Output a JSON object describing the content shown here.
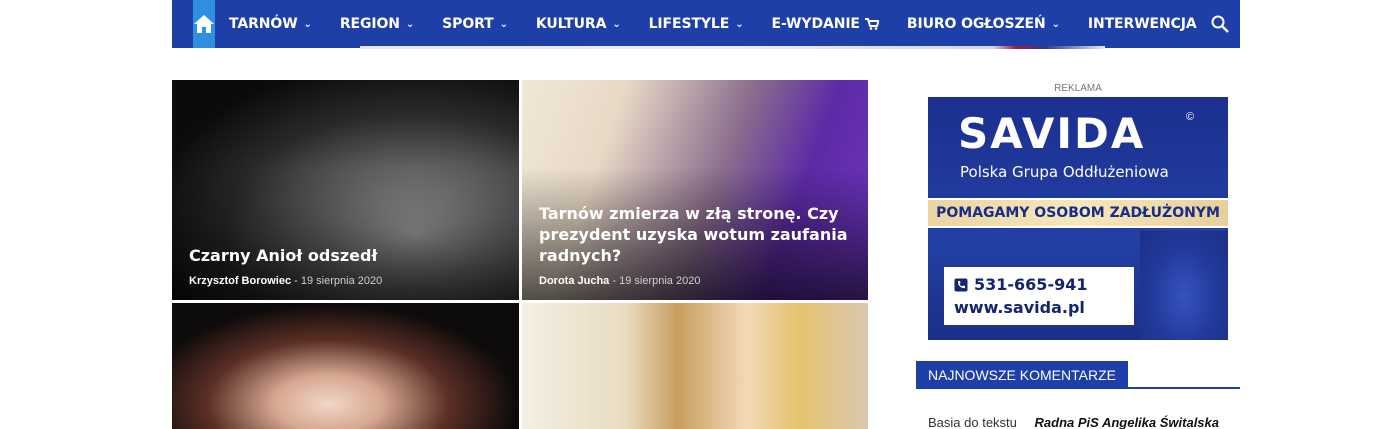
{
  "nav": {
    "items": [
      {
        "label": "TARNÓW",
        "has_dropdown": true
      },
      {
        "label": "REGION",
        "has_dropdown": true
      },
      {
        "label": "SPORT",
        "has_dropdown": true
      },
      {
        "label": "KULTURA",
        "has_dropdown": true
      },
      {
        "label": "LIFESTYLE",
        "has_dropdown": true
      },
      {
        "label": "E-WYDANIE",
        "has_dropdown": false
      },
      {
        "label": "BIURO OGŁOSZEŃ",
        "has_dropdown": true
      },
      {
        "label": "INTERWENCJA",
        "has_dropdown": false
      }
    ],
    "icons": {
      "home": "home-icon",
      "cart": "cart-icon",
      "search": "search-icon"
    },
    "colors": {
      "bar": "#1e3ea8",
      "home_bg": "#2f8fe0"
    }
  },
  "articles": [
    {
      "title": "Czarny Anioł odszedł",
      "author": "Krzysztof Borowiec",
      "date": "19 sierpnia 2020"
    },
    {
      "title": "Tarnów zmierza w złą stronę. Czy prezydent uzyska wotum zaufania radnych?",
      "author": "Dorota Jucha",
      "date": "19 sierpnia 2020"
    },
    {
      "title": "",
      "author": "",
      "date": ""
    },
    {
      "title": "",
      "author": "",
      "date": ""
    }
  ],
  "sidebar": {
    "ad_label": "REKLAMA",
    "ad": {
      "brand": "SAVIDA",
      "registered": "©",
      "subtitle": "Polska Grupa Oddłużeniowa",
      "slogan": "POMAGAMY OSOBOM ZADŁUŻONYM",
      "phone": "531-665-941",
      "website": "www.savida.pl"
    },
    "widget_title": "NAJNOWSZE KOMENTARZE",
    "comments": [
      {
        "author": "Basia do tekstu",
        "article": "Radna PiS Angelika Świtalska"
      }
    ]
  }
}
